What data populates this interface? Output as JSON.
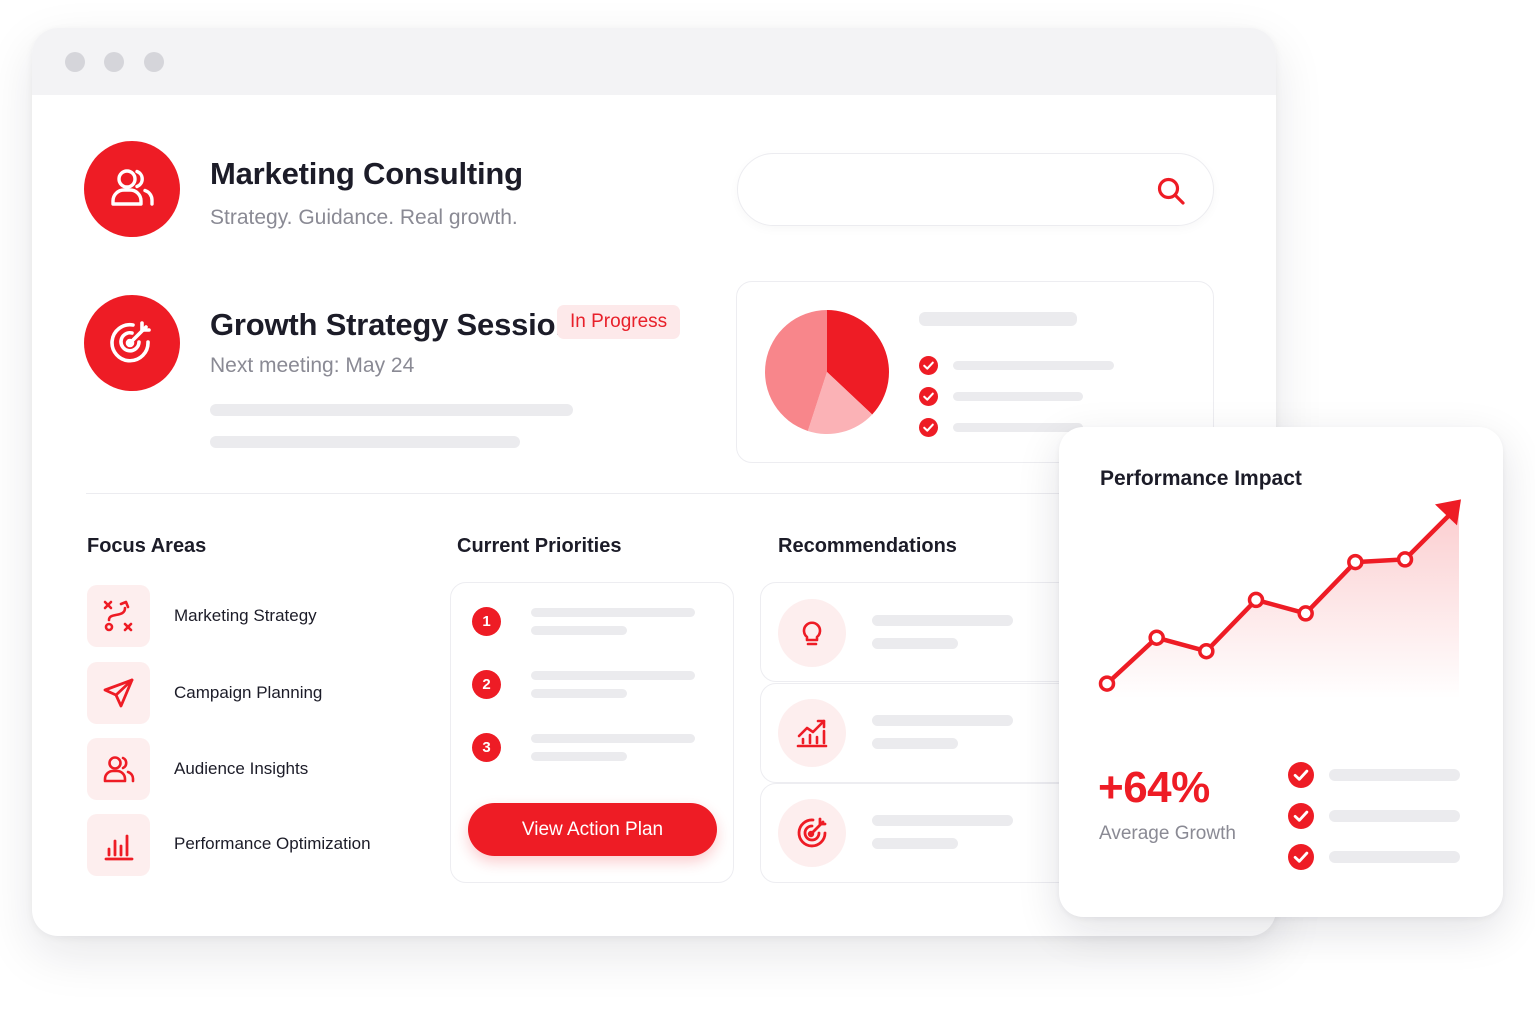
{
  "window": {
    "controls": [
      "close",
      "minimize",
      "maximize"
    ]
  },
  "header": {
    "title": "Marketing Consulting",
    "subtitle": "Strategy. Guidance. Real growth.",
    "icon": "users-icon"
  },
  "session": {
    "title": "Growth Strategy Session",
    "status": "In Progress",
    "next_meeting": "Next meeting: May 24",
    "icon": "target-icon"
  },
  "search": {
    "placeholder": "",
    "icon": "search-icon"
  },
  "colors": {
    "accent": "#ee1c25",
    "accent_light": "#f8868b",
    "accent_soft": "#fdeeee",
    "muted_text": "#8a8a94"
  },
  "summary_card": {
    "pie": {
      "slices": [
        0.37,
        0.18,
        0.45
      ],
      "colors": [
        "#ee1c25",
        "#fbb2b6",
        "#f8868b"
      ]
    },
    "checklist_count": 3
  },
  "focus": {
    "label": "Focus Areas",
    "items": [
      {
        "label": "Marketing Strategy",
        "icon": "strategy-icon"
      },
      {
        "label": "Campaign Planning",
        "icon": "paper-plane-icon"
      },
      {
        "label": "Audience Insights",
        "icon": "audience-icon"
      },
      {
        "label": "Performance Optimization",
        "icon": "bar-chart-icon"
      }
    ]
  },
  "priorities": {
    "label": "Current Priorities",
    "numbers": [
      "1",
      "2",
      "3"
    ],
    "cta": "View Action Plan"
  },
  "recommendations": {
    "label": "Recommendations",
    "items": [
      {
        "icon": "lightbulb-icon"
      },
      {
        "icon": "trend-up-icon"
      },
      {
        "icon": "target-icon"
      }
    ]
  },
  "performance": {
    "title": "Performance Impact",
    "growth_value": "+64%",
    "growth_label": "Average Growth",
    "checklist_count": 3
  },
  "chart_data": {
    "type": "line",
    "title": "Performance Impact",
    "x": [
      1,
      2,
      3,
      4,
      5,
      6,
      7
    ],
    "series": [
      {
        "values": [
          2,
          19,
          14,
          33,
          28,
          47,
          48
        ]
      }
    ],
    "trend_end": 68,
    "ylim": [
      0,
      70
    ],
    "grid": false,
    "axes_visible": false
  }
}
